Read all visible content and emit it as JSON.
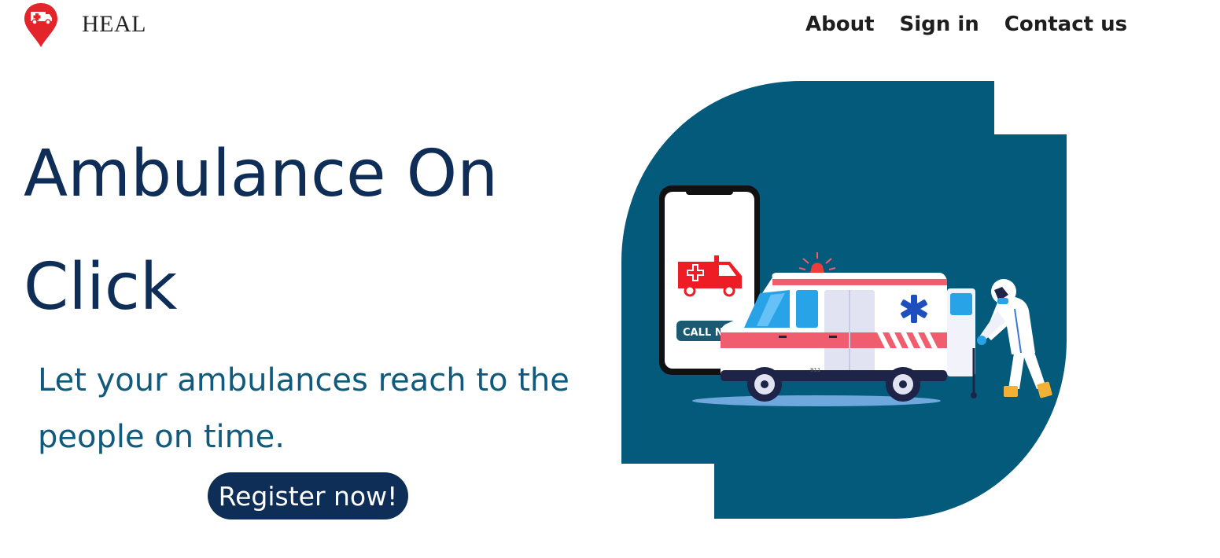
{
  "header": {
    "brand": "HEAL",
    "logo_icon": "ambulance-location-pin-icon",
    "nav": {
      "about": "About",
      "sign_in": "Sign in",
      "contact": "Contact us"
    }
  },
  "hero": {
    "title": "Ambulance On Click",
    "subtitle": "Let your ambulances reach to the people on time.",
    "register_label": "Register now!"
  },
  "illustration": {
    "call_now_label": "CALL NOW",
    "vehicle_number": "911",
    "icons": [
      "smartphone-icon",
      "ambulance-icon",
      "siren-icon",
      "star-of-life-icon",
      "paramedic-icon"
    ]
  },
  "colors": {
    "navy": "#0f2e57",
    "teal": "#045a7a",
    "subtitle": "#0f5a7d",
    "ambulance_red": "#e8202a",
    "stripe_pink": "#ef5d6e"
  }
}
